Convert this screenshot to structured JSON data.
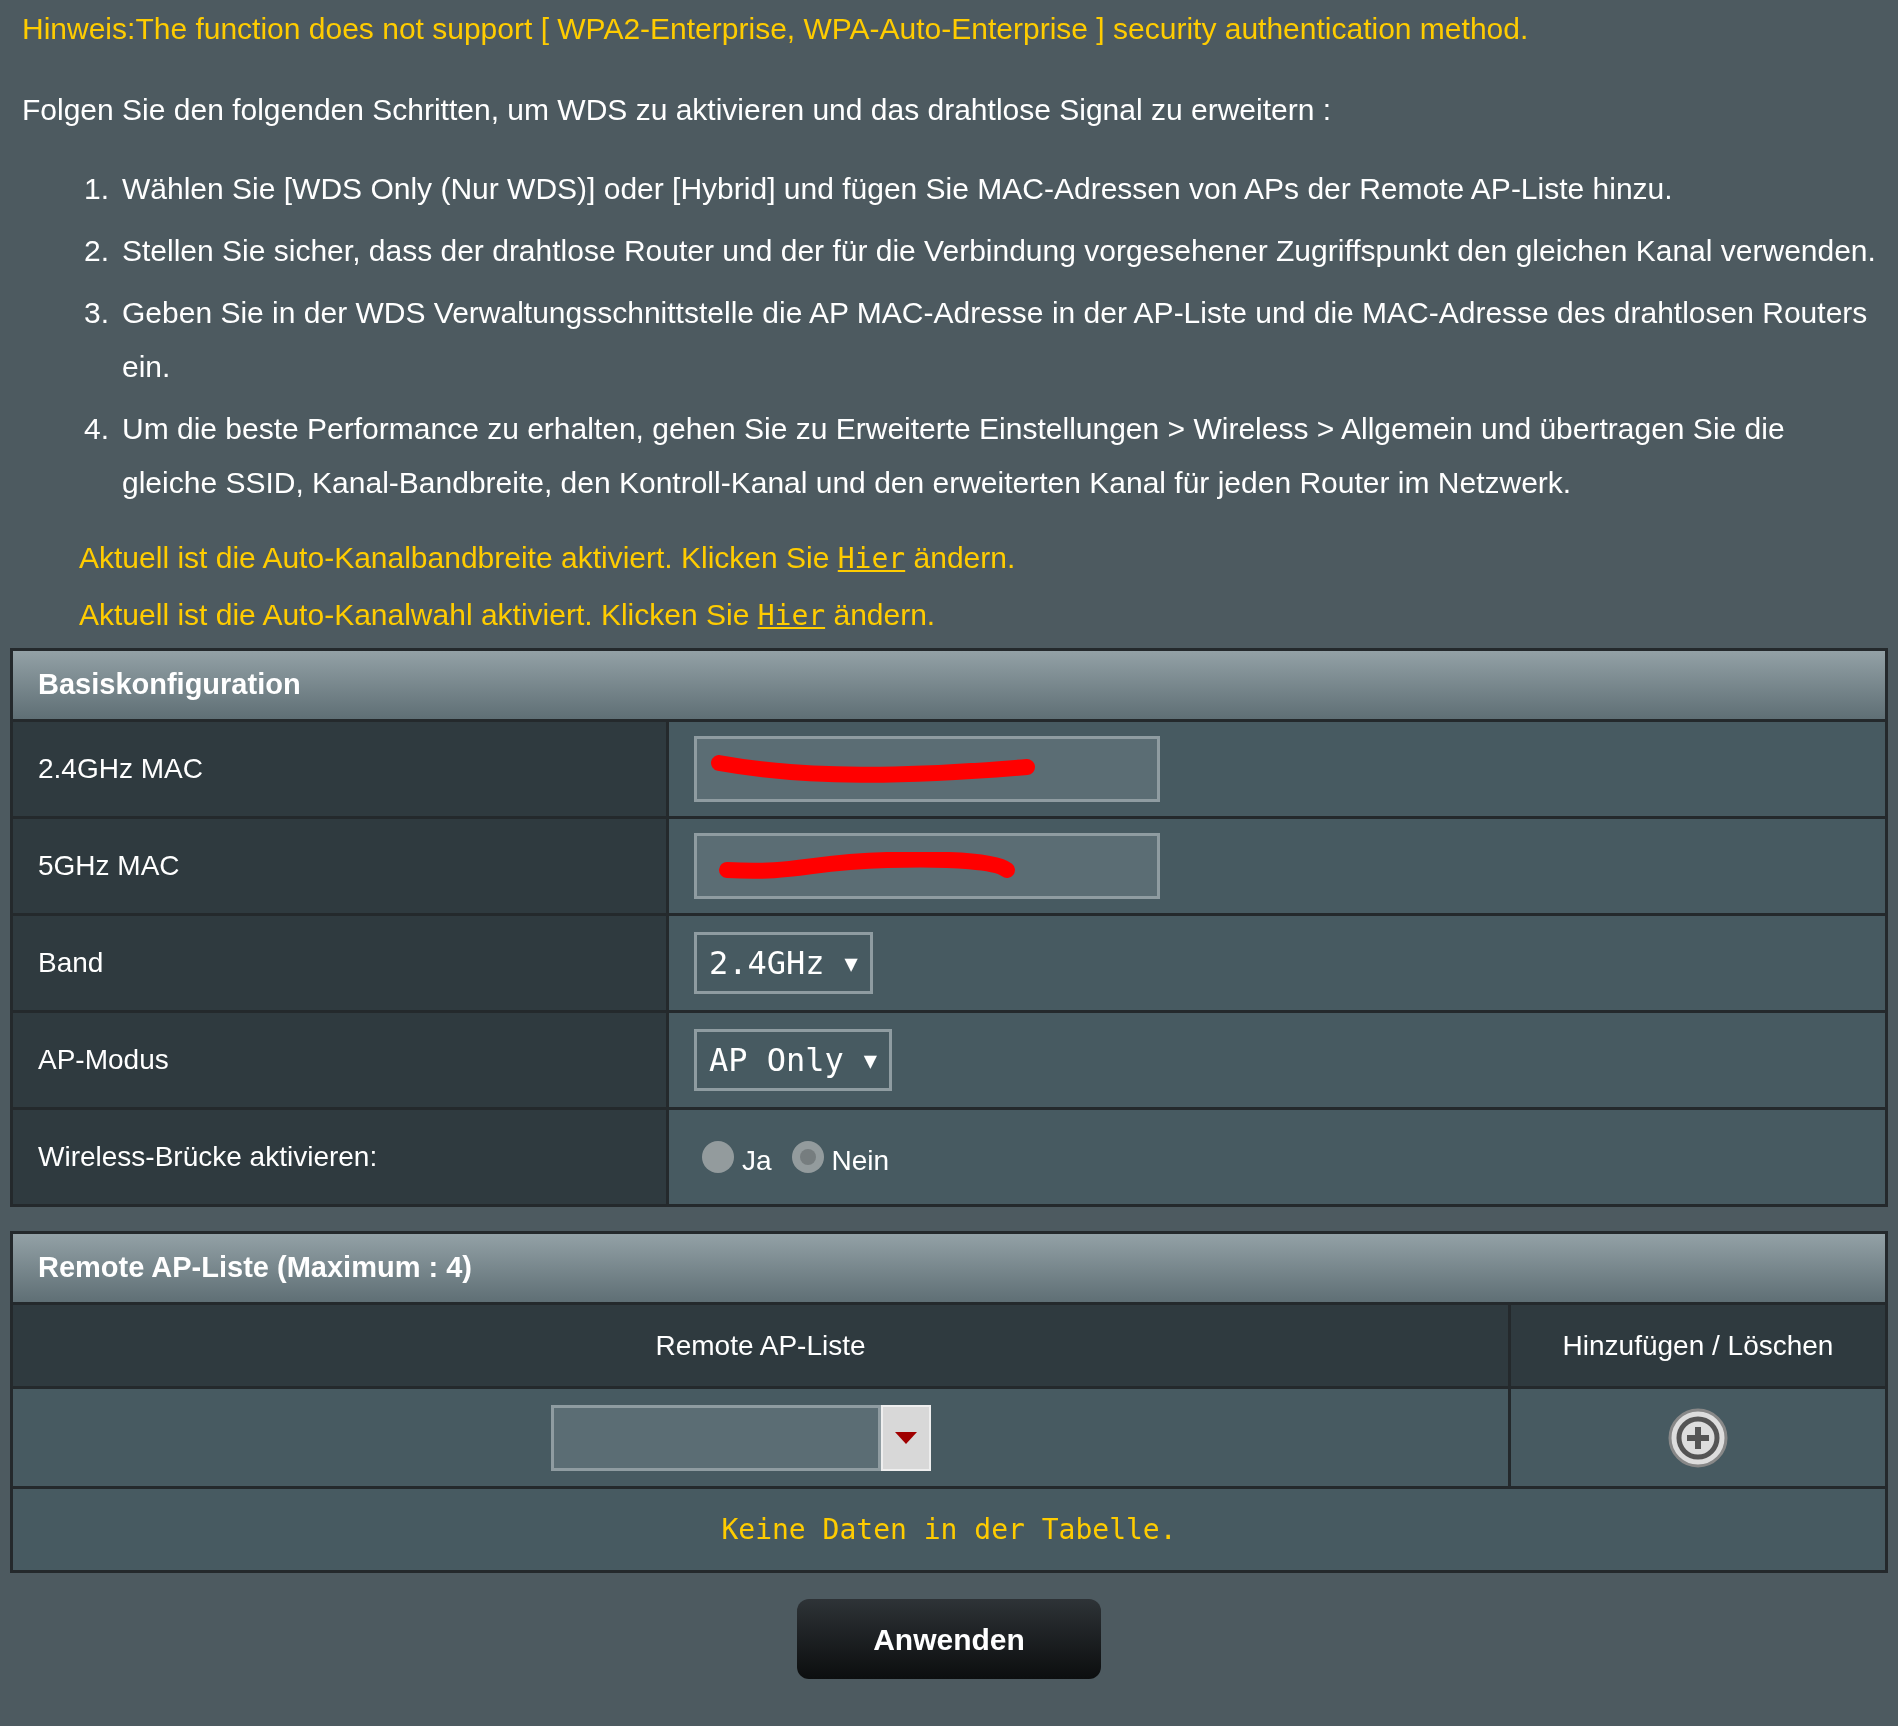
{
  "hint": {
    "label": "Hinweis:",
    "text": "The function does not support [ WPA2-Enterprise, WPA-Auto-Enterprise ] security authentication method."
  },
  "intro": "Folgen Sie den folgenden Schritten, um WDS zu aktivieren und das drahtlose Signal zu erweitern :",
  "steps": [
    {
      "number": "1.",
      "text": "Wählen Sie [WDS Only (Nur WDS)] oder [Hybrid] und fügen Sie MAC-Adressen von APs der Remote AP-Liste hinzu."
    },
    {
      "number": "2.",
      "text": "Stellen Sie sicher, dass der drahtlose Router und der für die Verbindung vorgesehener Zugriffspunkt den gleichen Kanal verwenden."
    },
    {
      "number": "3.",
      "text": "Geben Sie in der WDS Verwaltungsschnittstelle die AP MAC-Adresse in der AP-Liste und die MAC-Adresse des drahtlosen Routers ein."
    },
    {
      "number": "4.",
      "text": "Um die beste Performance zu erhalten, gehen Sie zu Erweiterte Einstellungen > Wireless > Allgemein und übertragen Sie die gleiche SSID, Kanal-Bandbreite, den Kontroll-Kanal und den erweiterten Kanal für jeden Router im Netzwerk."
    }
  ],
  "notices": [
    {
      "before": "Aktuell ist die Auto-Kanalbandbreite aktiviert. Klicken Sie",
      "link": "Hier",
      "after": "ändern."
    },
    {
      "before": "Aktuell ist die Auto-Kanalwahl aktiviert. Klicken Sie",
      "link": "Hier",
      "after": "ändern."
    }
  ],
  "basic": {
    "title": "Basiskonfiguration",
    "rows": [
      {
        "kind": "mac",
        "label": "2.4GHz MAC"
      },
      {
        "kind": "mac",
        "label": "5GHz MAC"
      },
      {
        "kind": "select",
        "label": "Band",
        "value": "2.4GHz",
        "arrow": "▼"
      },
      {
        "kind": "select",
        "label": "AP-Modus",
        "value": "AP Only",
        "arrow": "▼"
      },
      {
        "kind": "radio",
        "label": "Wireless-Brücke aktivieren:",
        "options": [
          {
            "label": "Ja",
            "selected": false
          },
          {
            "label": "Nein",
            "selected": true
          }
        ]
      }
    ]
  },
  "remote": {
    "title": "Remote AP-Liste (Maximum : 4)",
    "columns": [
      "Remote AP-Liste",
      "Hinzufügen / Löschen"
    ],
    "empty": "Keine Daten in der Tabelle."
  },
  "apply": "Anwenden"
}
